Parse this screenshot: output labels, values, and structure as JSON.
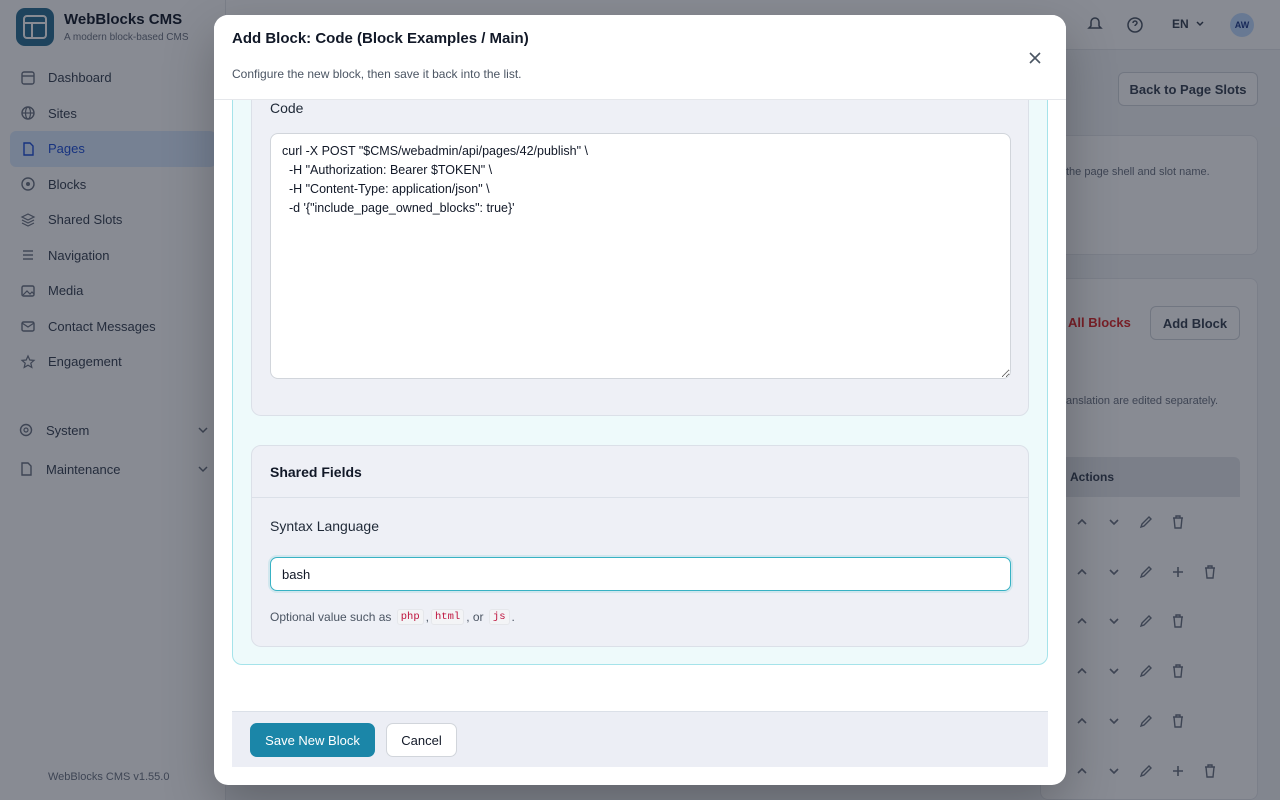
{
  "app": {
    "brand_name": "WebBlocks CMS",
    "brand_tagline": "A modern block-based CMS",
    "version": "WebBlocks CMS v1.55.0",
    "language": "EN",
    "user_initials": "AW"
  },
  "sidebar": {
    "items": [
      {
        "label": "Dashboard",
        "icon": "dashboard-icon"
      },
      {
        "label": "Sites",
        "icon": "globe-icon"
      },
      {
        "label": "Pages",
        "icon": "page-icon",
        "active": true
      },
      {
        "label": "Blocks",
        "icon": "blocks-icon"
      },
      {
        "label": "Shared Slots",
        "icon": "layers-icon"
      },
      {
        "label": "Navigation",
        "icon": "menu-icon"
      },
      {
        "label": "Media",
        "icon": "image-icon"
      },
      {
        "label": "Contact Messages",
        "icon": "mail-icon"
      },
      {
        "label": "Engagement",
        "icon": "star-icon"
      }
    ],
    "groups": [
      {
        "label": "System",
        "icon": "gear-icon"
      },
      {
        "label": "Maintenance",
        "icon": "file-icon"
      }
    ]
  },
  "background": {
    "back_button": "Back to Page Slots",
    "slot_hint": "the page shell and slot name.",
    "all_blocks_link": "All Blocks",
    "add_block_button": "Add Block",
    "translation_hint": "anslation are edited separately.",
    "actions_header": "Actions"
  },
  "modal": {
    "title": "Add Block: Code (Block Examples / Main)",
    "subtitle": "Configure the new block, then save it back into the list.",
    "code_label": "Code",
    "code_value": "curl -X POST \"$CMS/webadmin/api/pages/42/publish\" \\\n  -H \"Authorization: Bearer $TOKEN\" \\\n  -H \"Content-Type: application/json\" \\\n  -d '{\"include_page_owned_blocks\": true}'",
    "shared_fields_title": "Shared Fields",
    "syntax_label": "Syntax Language",
    "syntax_value": "bash",
    "helper_prefix": "Optional value such as",
    "helper_chips": [
      "php",
      "html",
      "js"
    ],
    "helper_sep1": ",",
    "helper_sep2": ", or",
    "helper_end": ".",
    "save_button": "Save New Block",
    "cancel_button": "Cancel"
  },
  "colors": {
    "primary": "#1b86a8",
    "accent_border": "#a5e3ea",
    "danger": "#dc2626"
  }
}
